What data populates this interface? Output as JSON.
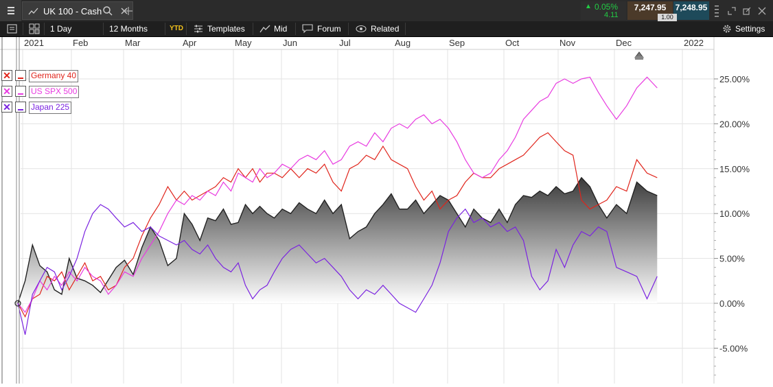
{
  "instrument": {
    "tab_title": "UK 100 - Cash",
    "change_pct": "0.05%",
    "change_abs": "4.11",
    "bid": "7,247.95",
    "ask": "7,248.95",
    "spread": "1.00"
  },
  "toolbar": {
    "interval": "1 Day",
    "range": "12 Months",
    "ytd": "YTD",
    "templates": "Templates",
    "mid": "Mid",
    "forum": "Forum",
    "related": "Related",
    "settings": "Settings"
  },
  "colors": {
    "main": "#222222",
    "germany": "#e0241b",
    "spx": "#e83ae0",
    "japan": "#7a22e0",
    "up": "#22cc44"
  },
  "legend": [
    {
      "label": "Germany 40",
      "color": "#e0241b"
    },
    {
      "label": "US SPX 500",
      "color": "#e83ae0"
    },
    {
      "label": "Japan 225",
      "color": "#7a22e0"
    }
  ],
  "chart_data": {
    "type": "line",
    "x_ticks": [
      "2021",
      "Feb",
      "Mar",
      "Apr",
      "May",
      "Jun",
      "Jul",
      "Aug",
      "Sep",
      "Oct",
      "Nov",
      "Dec",
      "2022"
    ],
    "y_ticks": [
      "25.00%",
      "20.00%",
      "15.00%",
      "10.00%",
      "5.00%",
      "0.00%",
      "-5.00%"
    ],
    "y_values": [
      25,
      20,
      15,
      10,
      5,
      0,
      -5
    ],
    "ylim": [
      -7.5,
      28.5
    ],
    "xlim": [
      0,
      12.6
    ],
    "grid": true,
    "legend_position": "top-left",
    "series": [
      {
        "name": "UK 100 - Cash",
        "style": "area",
        "x": [
          0,
          0.15,
          0.3,
          0.45,
          0.6,
          0.75,
          0.9,
          1.05,
          1.2,
          1.35,
          1.5,
          1.65,
          1.8,
          1.95,
          2.1,
          2.25,
          2.4,
          2.55,
          2.7,
          2.85,
          3.0,
          3.15,
          3.3,
          3.45,
          3.6,
          3.75,
          3.9,
          4.05,
          4.2,
          4.35,
          4.5,
          4.65,
          4.8,
          4.95,
          5.1,
          5.25,
          5.4,
          5.55,
          5.7,
          5.85,
          6.0,
          6.15,
          6.3,
          6.45,
          6.6,
          6.75,
          6.9,
          7.05,
          7.2,
          7.35,
          7.5,
          7.65,
          7.8,
          7.95,
          8.1,
          8.25,
          8.4,
          8.55,
          8.7,
          8.85,
          9.0,
          9.15,
          9.3,
          9.45,
          9.6,
          9.75,
          9.9,
          10.05,
          10.2,
          10.35,
          10.5,
          10.65,
          10.8,
          10.95,
          11.1,
          11.25,
          11.4,
          11.55,
          11.7
        ],
        "values": [
          0,
          2.5,
          6.5,
          4.2,
          3.5,
          1.5,
          1.0,
          5.0,
          2.8,
          2.5,
          2.0,
          1.2,
          2.6,
          4.0,
          4.8,
          3.2,
          6.2,
          8.5,
          7.0,
          4.2,
          5.0,
          10.0,
          8.8,
          7.0,
          9.5,
          9.2,
          10.5,
          8.8,
          9.0,
          11.0,
          10.0,
          10.8,
          10.0,
          9.5,
          10.5,
          10.0,
          11.2,
          10.5,
          10.0,
          11.5,
          10.0,
          11.0,
          7.2,
          8.0,
          8.5,
          10.0,
          11.0,
          12.2,
          10.5,
          10.5,
          11.5,
          10.0,
          11.0,
          12.0,
          11.5,
          10.0,
          8.5,
          10.5,
          9.5,
          9.0,
          10.5,
          9.0,
          11.0,
          12.0,
          11.8,
          12.5,
          12.0,
          13.0,
          12.2,
          12.5,
          14.0,
          13.0,
          11.0,
          9.5,
          11.0,
          10.0,
          13.5,
          12.5,
          12.0
        ]
      },
      {
        "name": "Germany 40",
        "style": "line",
        "x": [
          0,
          0.15,
          0.3,
          0.45,
          0.6,
          0.75,
          0.9,
          1.05,
          1.2,
          1.35,
          1.5,
          1.65,
          1.8,
          1.95,
          2.1,
          2.25,
          2.4,
          2.55,
          2.7,
          2.85,
          3.0,
          3.15,
          3.3,
          3.45,
          3.6,
          3.75,
          3.9,
          4.05,
          4.2,
          4.35,
          4.5,
          4.65,
          4.8,
          4.95,
          5.1,
          5.25,
          5.4,
          5.55,
          5.7,
          5.85,
          6.0,
          6.15,
          6.3,
          6.45,
          6.6,
          6.75,
          6.9,
          7.05,
          7.2,
          7.35,
          7.5,
          7.65,
          7.8,
          7.95,
          8.1,
          8.25,
          8.4,
          8.55,
          8.7,
          8.85,
          9.0,
          9.15,
          9.3,
          9.45,
          9.6,
          9.75,
          9.9,
          10.05,
          10.2,
          10.35,
          10.5,
          10.65,
          10.8,
          10.95,
          11.1,
          11.25,
          11.4,
          11.55,
          11.7
        ],
        "values": [
          0,
          -1.5,
          0.5,
          1.0,
          3.0,
          2.5,
          3.5,
          1.5,
          3.0,
          4.5,
          2.5,
          3.0,
          1.5,
          2.0,
          4.0,
          5.0,
          7.5,
          9.5,
          11.0,
          13.0,
          11.5,
          12.5,
          11.5,
          12.0,
          12.5,
          13.0,
          14.0,
          13.5,
          15.0,
          14.0,
          15.0,
          13.5,
          14.5,
          14.5,
          14.0,
          15.0,
          14.0,
          15.0,
          14.5,
          15.5,
          13.5,
          12.5,
          15.0,
          15.5,
          16.5,
          16.0,
          17.5,
          16.0,
          15.5,
          15.0,
          13.0,
          11.5,
          12.5,
          10.5,
          11.5,
          12.0,
          13.5,
          14.5,
          14.0,
          14.0,
          15.0,
          15.5,
          16.0,
          16.5,
          17.5,
          18.5,
          19.0,
          18.0,
          17.0,
          16.5,
          11.5,
          10.5,
          11.0,
          11.5,
          13.0,
          12.5,
          16.0,
          14.5,
          14.0
        ]
      },
      {
        "name": "US SPX 500",
        "style": "line",
        "x": [
          0,
          0.15,
          0.3,
          0.45,
          0.6,
          0.75,
          0.9,
          1.05,
          1.2,
          1.35,
          1.5,
          1.65,
          1.8,
          1.95,
          2.1,
          2.25,
          2.4,
          2.55,
          2.7,
          2.85,
          3.0,
          3.15,
          3.3,
          3.45,
          3.6,
          3.75,
          3.9,
          4.05,
          4.2,
          4.35,
          4.5,
          4.65,
          4.8,
          4.95,
          5.1,
          5.25,
          5.4,
          5.55,
          5.7,
          5.85,
          6.0,
          6.15,
          6.3,
          6.45,
          6.6,
          6.75,
          6.9,
          7.05,
          7.2,
          7.35,
          7.5,
          7.65,
          7.8,
          7.95,
          8.1,
          8.25,
          8.4,
          8.55,
          8.7,
          8.85,
          9.0,
          9.15,
          9.3,
          9.45,
          9.6,
          9.75,
          9.9,
          10.05,
          10.2,
          10.35,
          10.5,
          10.65,
          10.8,
          10.95,
          11.1,
          11.25,
          11.4,
          11.55,
          11.7
        ],
        "values": [
          0,
          -1.0,
          0.5,
          2.5,
          1.5,
          3.0,
          2.0,
          3.5,
          2.5,
          4.0,
          3.0,
          2.5,
          1.0,
          2.0,
          3.5,
          3.0,
          5.0,
          6.5,
          8.0,
          10.0,
          11.5,
          11.0,
          12.0,
          11.5,
          12.5,
          12.0,
          13.5,
          12.5,
          14.5,
          14.0,
          13.5,
          15.0,
          14.0,
          14.5,
          15.5,
          15.0,
          16.0,
          16.5,
          16.0,
          17.0,
          15.5,
          16.0,
          17.5,
          18.0,
          17.5,
          19.0,
          18.0,
          19.5,
          20.0,
          19.5,
          20.5,
          21.0,
          20.0,
          20.5,
          19.5,
          18.0,
          16.0,
          14.5,
          14.0,
          14.5,
          16.0,
          17.0,
          18.5,
          20.5,
          21.5,
          22.5,
          23.0,
          24.5,
          25.0,
          24.5,
          25.0,
          25.2,
          23.5,
          22.0,
          20.5,
          22.0,
          24.0,
          25.2,
          24.0
        ]
      },
      {
        "name": "Japan 225",
        "style": "line",
        "x": [
          0,
          0.15,
          0.3,
          0.45,
          0.6,
          0.75,
          0.9,
          1.05,
          1.2,
          1.35,
          1.5,
          1.65,
          1.8,
          1.95,
          2.1,
          2.25,
          2.4,
          2.55,
          2.7,
          2.85,
          3.0,
          3.15,
          3.3,
          3.45,
          3.6,
          3.75,
          3.9,
          4.05,
          4.2,
          4.35,
          4.5,
          4.65,
          4.8,
          4.95,
          5.1,
          5.25,
          5.4,
          5.55,
          5.7,
          5.85,
          6.0,
          6.15,
          6.3,
          6.45,
          6.6,
          6.75,
          6.9,
          7.05,
          7.2,
          7.35,
          7.5,
          7.65,
          7.8,
          7.95,
          8.1,
          8.25,
          8.4,
          8.55,
          8.7,
          8.85,
          9.0,
          9.15,
          9.3,
          9.45,
          9.6,
          9.75,
          9.9,
          10.05,
          10.2,
          10.35,
          10.5,
          10.65,
          10.8,
          10.95,
          11.1,
          11.25,
          11.4,
          11.55,
          11.7
        ],
        "values": [
          0,
          -3.5,
          1.0,
          2.5,
          4.0,
          3.5,
          1.5,
          3.0,
          5.0,
          8.0,
          10.0,
          11.0,
          10.5,
          9.5,
          8.5,
          9.0,
          8.0,
          8.5,
          7.5,
          7.0,
          6.5,
          7.0,
          6.0,
          5.5,
          6.5,
          5.0,
          4.0,
          3.5,
          4.5,
          2.0,
          0.5,
          1.5,
          2.0,
          3.5,
          5.0,
          6.0,
          6.5,
          5.5,
          4.5,
          5.0,
          4.0,
          3.0,
          1.5,
          0.5,
          1.5,
          1.0,
          2.0,
          1.0,
          0.0,
          -0.5,
          -1.0,
          0.5,
          2.0,
          4.5,
          8.0,
          9.5,
          10.5,
          9.0,
          9.5,
          8.5,
          9.0,
          8.0,
          8.5,
          7.0,
          3.0,
          1.5,
          2.5,
          6.0,
          4.0,
          6.5,
          8.0,
          7.5,
          8.5,
          8.0,
          4.0,
          3.5,
          3.0,
          0.5,
          3.0
        ]
      }
    ]
  }
}
